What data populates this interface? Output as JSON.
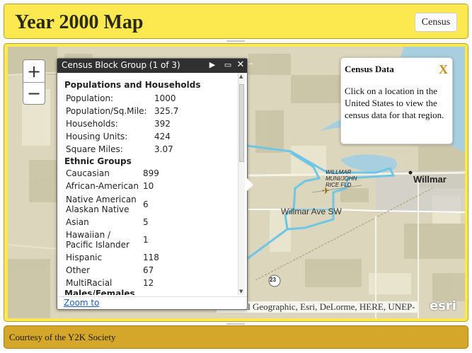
{
  "header": {
    "title": "Year 2000 Map",
    "census_button": "Census"
  },
  "map": {
    "place_label": "Willmar",
    "airport_label_lines": [
      "WILLMAR",
      "MUNI/JOHN",
      "RICE FLD"
    ],
    "road_label": "Willmar Ave SW",
    "route_shield": "23",
    "attribution": "National Geographic, Esri, DeLorme, HERE, UNEP-",
    "logo": "esri",
    "zoom_in": "+",
    "zoom_out": "−",
    "boundary_color": "#6ec6e6",
    "water_color": "#a7cfe0"
  },
  "popup": {
    "title": "Census Block Group (1 of 3)",
    "sections": {
      "populations": {
        "title": "Populations and Households",
        "rows": [
          {
            "label": "Population:",
            "value": "1000"
          },
          {
            "label": "Population/Sq.Mile:",
            "value": "325.7"
          },
          {
            "label": "Households:",
            "value": "392"
          },
          {
            "label": "Housing Units:",
            "value": "424"
          },
          {
            "label": "Square Miles:",
            "value": "3.07"
          }
        ]
      },
      "ethnic": {
        "title": "Ethnic Groups",
        "rows": [
          {
            "label": "Caucasian",
            "value": "899"
          },
          {
            "label": "African-American",
            "value": "10"
          },
          {
            "label_lines": [
              "Native American",
              "Alaskan Native"
            ],
            "value": "6"
          },
          {
            "label": "Asian",
            "value": "5"
          },
          {
            "label_lines": [
              "Hawaiian /",
              "Pacific Islander"
            ],
            "value": "1"
          },
          {
            "label": "Hispanic",
            "value": "118"
          },
          {
            "label": "Other",
            "value": "67"
          },
          {
            "label": "MultiRacial",
            "value": "12"
          }
        ]
      },
      "males_females": {
        "title": "Males/Females"
      }
    },
    "zoom_link": "Zoom to"
  },
  "info_panel": {
    "title": "Census Data",
    "close": "X",
    "text": "Click on a location in the United States to view the census data for that region."
  },
  "footer": {
    "text": "Courtesy of the Y2K Society"
  }
}
